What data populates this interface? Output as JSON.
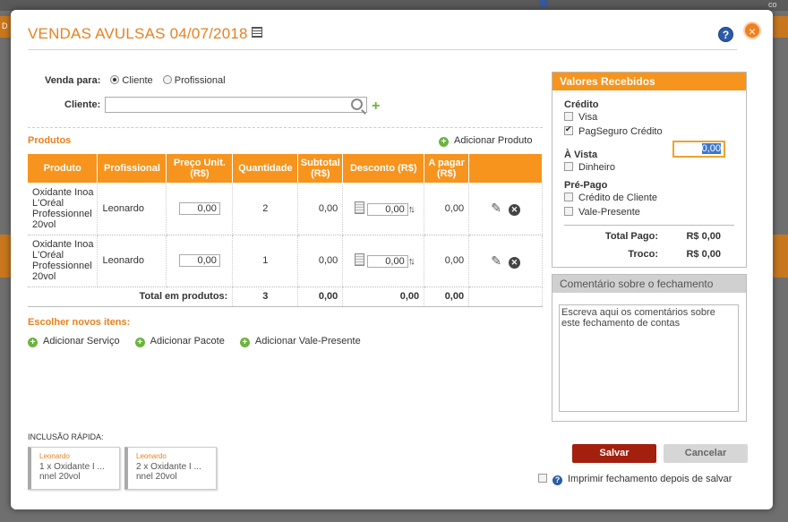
{
  "background": {
    "left_tab_text": "D",
    "right_text": "co"
  },
  "modal": {
    "title": "VENDAS AVULSAS 04/07/2018",
    "help": "?",
    "close": "×"
  },
  "venda": {
    "label": "Venda para:",
    "option_cliente": "Cliente",
    "option_profissional": "Profissional",
    "selected": "Cliente"
  },
  "cliente": {
    "label": "Cliente:",
    "value": ""
  },
  "produtos": {
    "section_title": "Produtos",
    "add_label": "Adicionar Produto",
    "headers": [
      "Produto",
      "Profissional",
      "Preço Unit.\n(R$)",
      "Quantidade",
      "Subtotal\n(R$)",
      "Desconto (R$)",
      "A pagar\n(R$)",
      ""
    ],
    "rows": [
      {
        "produto": "Oxidante Inoa L'Oréal Professionnel 20vol",
        "profissional": "Leonardo",
        "preco": "0,00",
        "quantidade": "2",
        "subtotal": "0,00",
        "desconto": "0,00",
        "a_pagar": "0,00"
      },
      {
        "produto": "Oxidante Inoa L'Oréal Professionnel 20vol",
        "profissional": "Leonardo",
        "preco": "0,00",
        "quantidade": "1",
        "subtotal": "0,00",
        "desconto": "0,00",
        "a_pagar": "0,00"
      }
    ],
    "total_label": "Total em produtos:",
    "total_quantidade": "3",
    "total_subtotal": "0,00",
    "total_desconto": "0,00",
    "total_a_pagar": "0,00"
  },
  "novos_itens": {
    "title": "Escolher novos itens:",
    "add_servico": "Adicionar Serviço",
    "add_pacote": "Adicionar Pacote",
    "add_vale": "Adicionar Vale-Presente"
  },
  "inclusao_rapida": {
    "title": "INCLUSÃO RÁPIDA:",
    "cards": [
      {
        "who": "Leonardo",
        "line1": "1 x Oxidante I ...",
        "line2": "nnel 20vol"
      },
      {
        "who": "Leonardo",
        "line1": "2 x Oxidante I ...",
        "line2": "nnel 20vol"
      }
    ]
  },
  "valores": {
    "title": "Valores Recebidos",
    "credito_label": "Crédito",
    "visa": "Visa",
    "pagseguro": "PagSeguro Crédito",
    "pagseguro_value": "0,00",
    "avista_label": "À Vista",
    "dinheiro": "Dinheiro",
    "prepago_label": "Pré-Pago",
    "credito_cliente": "Crédito de Cliente",
    "vale_presente": "Vale-Presente",
    "total_pago_label": "Total Pago:",
    "total_pago_value": "R$ 0,00",
    "troco_label": "Troco:",
    "troco_value": "R$ 0,00"
  },
  "comentario": {
    "title": "Comentário sobre o fechamento",
    "placeholder": "Escreva aqui os comentários sobre este fechamento de contas"
  },
  "actions": {
    "salvar": "Salvar",
    "cancelar": "Cancelar",
    "imprimir": "Imprimir fechamento depois de salvar"
  },
  "colors": {
    "accent": "#f7941d",
    "title": "#e8801f",
    "save": "#a31f0e"
  }
}
